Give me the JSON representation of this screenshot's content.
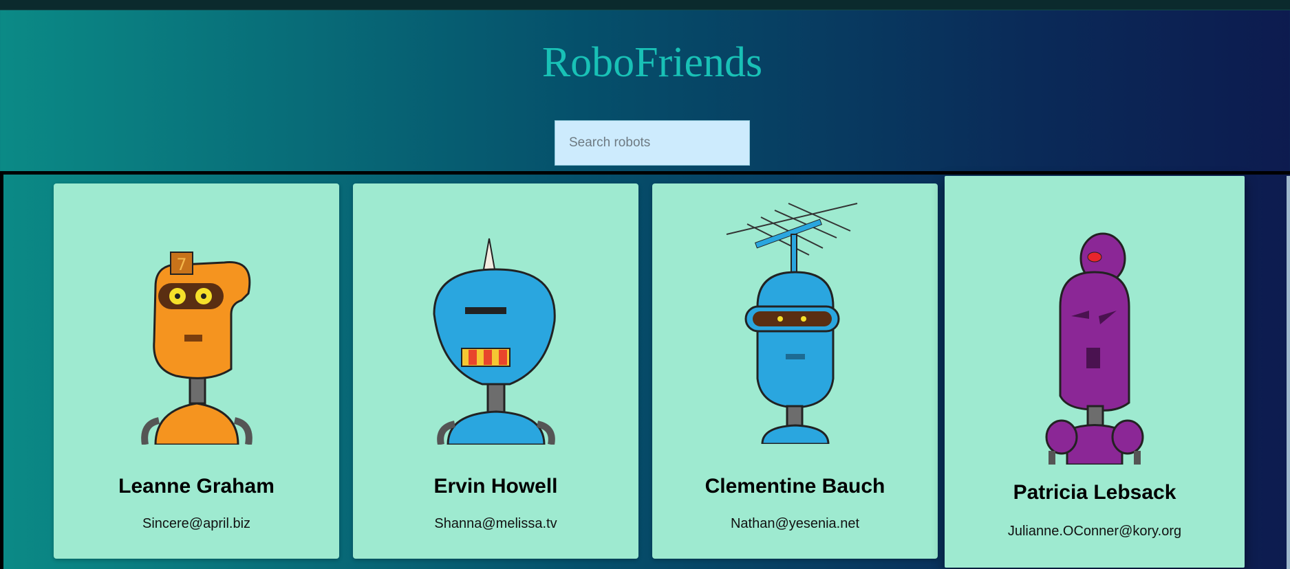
{
  "app": {
    "title": "RoboFriends"
  },
  "search": {
    "placeholder": "Search robots",
    "value": ""
  },
  "robots": [
    {
      "name": "Leanne Graham",
      "email": "Sincere@april.biz",
      "color": "#f5941f",
      "avatar_icon": "orange-robot-icon"
    },
    {
      "name": "Ervin Howell",
      "email": "Shanna@melissa.tv",
      "color": "#2aa6df",
      "avatar_icon": "blue-robot-icon"
    },
    {
      "name": "Clementine Bauch",
      "email": "Nathan@yesenia.net",
      "color": "#2aa6df",
      "avatar_icon": "antenna-robot-icon"
    },
    {
      "name": "Patricia Lebsack",
      "email": "Julianne.OConner@kory.org",
      "color": "#8b2796",
      "avatar_icon": "purple-robot-icon"
    }
  ]
}
